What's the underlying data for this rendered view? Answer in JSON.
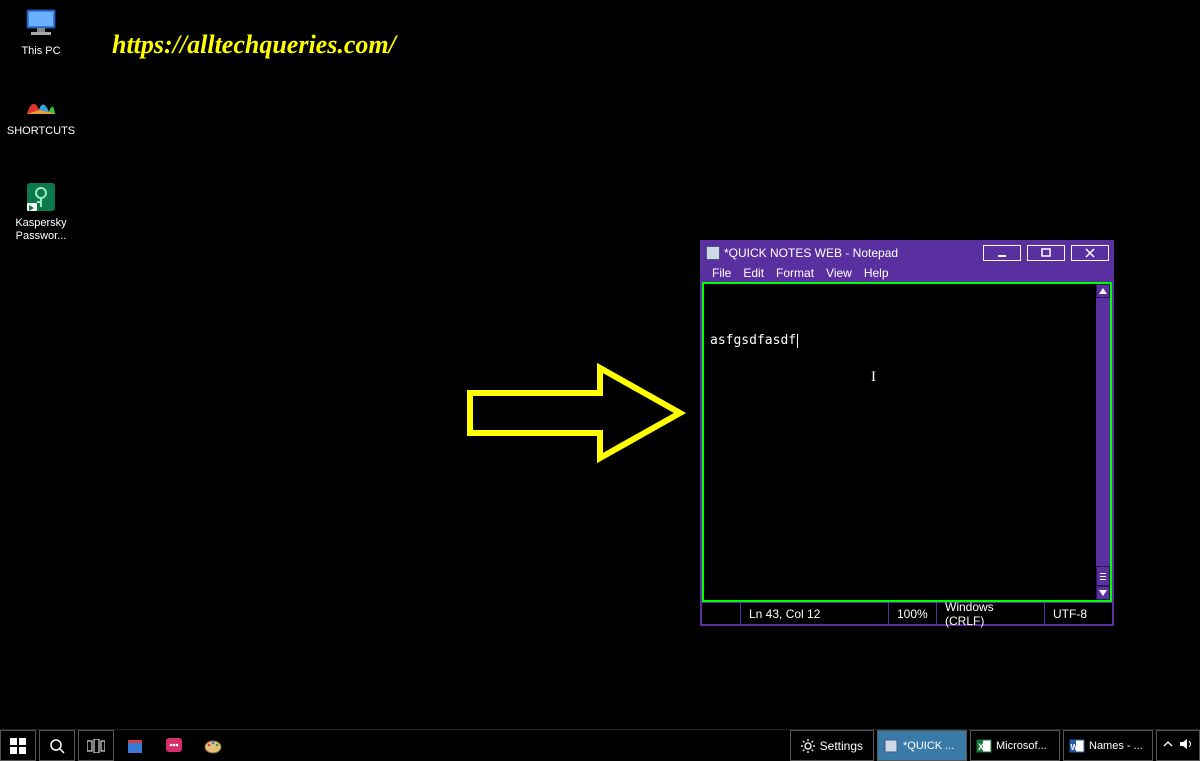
{
  "watermark": "https://alltechqueries.com/",
  "desktop_icons": [
    {
      "name": "this-pc",
      "label": "This PC"
    },
    {
      "name": "shortcuts",
      "label": "SHORTCUTS"
    },
    {
      "name": "kaspersky",
      "label": "Kaspersky Passwor..."
    }
  ],
  "notepad": {
    "title": "*QUICK NOTES WEB - Notepad",
    "menu": [
      "File",
      "Edit",
      "Format",
      "View",
      "Help"
    ],
    "content": "asfgsdfasdf",
    "status": {
      "position": "Ln 43, Col 12",
      "zoom": "100%",
      "line_ending": "Windows (CRLF)",
      "encoding": "UTF-8"
    }
  },
  "taskbar": {
    "settings": "Settings",
    "apps": [
      {
        "name": "notepad-task",
        "label": "*QUICK ...",
        "active": true
      },
      {
        "name": "excel-task",
        "label": "Microsof...",
        "active": false
      },
      {
        "name": "word-task",
        "label": "Names - ...",
        "active": false
      }
    ]
  }
}
